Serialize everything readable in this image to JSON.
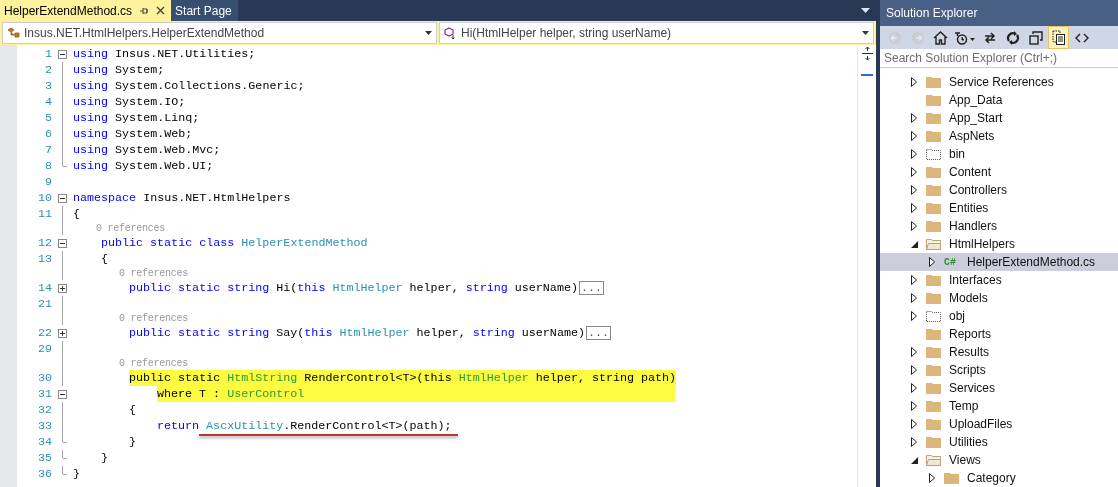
{
  "tabs": [
    {
      "label": "HelperExtendMethod.cs",
      "selected": true
    },
    {
      "label": "Start Page",
      "selected": false
    }
  ],
  "navigation_bar": {
    "type_dropdown": "Insus.NET.HtmlHelpers.HelperExtendMethod",
    "member_dropdown": "Hi(HtmlHelper helper, string userName)"
  },
  "code": [
    {
      "kind": "code",
      "number": "1",
      "expanded": true,
      "tokens": [
        {
          "t": "using ",
          "kind": "keyword"
        },
        {
          "t": "Insus.NET.Utilities;",
          "kind": "plain"
        }
      ]
    },
    {
      "kind": "code",
      "number": "2",
      "guide": true,
      "tokens": [
        {
          "t": "using ",
          "kind": "keyword"
        },
        {
          "t": "System;",
          "kind": "plain"
        }
      ]
    },
    {
      "kind": "code",
      "number": "3",
      "guide": true,
      "tokens": [
        {
          "t": "using ",
          "kind": "keyword"
        },
        {
          "t": "System.Collections.Generic;",
          "kind": "plain"
        }
      ]
    },
    {
      "kind": "code",
      "number": "4",
      "guide": true,
      "tokens": [
        {
          "t": "using ",
          "kind": "keyword"
        },
        {
          "t": "System.IO;",
          "kind": "plain"
        }
      ]
    },
    {
      "kind": "code",
      "number": "5",
      "guide": true,
      "tokens": [
        {
          "t": "using ",
          "kind": "keyword"
        },
        {
          "t": "System.Linq;",
          "kind": "plain"
        }
      ]
    },
    {
      "kind": "code",
      "number": "6",
      "guide": true,
      "tokens": [
        {
          "t": "using ",
          "kind": "keyword"
        },
        {
          "t": "System.Web;",
          "kind": "plain"
        }
      ]
    },
    {
      "kind": "code",
      "number": "7",
      "guide": true,
      "tokens": [
        {
          "t": "using ",
          "kind": "keyword"
        },
        {
          "t": "System.Web.Mvc;",
          "kind": "plain"
        }
      ]
    },
    {
      "kind": "code",
      "number": "8",
      "block_end": true,
      "tokens": [
        {
          "t": "using ",
          "kind": "keyword"
        },
        {
          "t": "System.Web.UI;",
          "kind": "plain"
        }
      ]
    },
    {
      "kind": "code",
      "number": "9"
    },
    {
      "kind": "code",
      "number": "10",
      "expanded": true,
      "tokens": [
        {
          "t": "namespace ",
          "kind": "keyword"
        },
        {
          "t": "Insus.NET.HtmlHelpers",
          "kind": "plain"
        }
      ]
    },
    {
      "kind": "code",
      "number": "11",
      "guide": true,
      "tokens": [
        {
          "t": "{",
          "kind": "plain"
        }
      ]
    },
    {
      "kind": "lens",
      "text": "    0 references"
    },
    {
      "kind": "code",
      "number": "12",
      "expanded": true,
      "tokens": [
        {
          "t": "    public static class ",
          "kind": "keyword"
        },
        {
          "t": "HelperExtendMethod",
          "kind": "type"
        }
      ]
    },
    {
      "kind": "code",
      "number": "13",
      "guide": true,
      "tokens": [
        {
          "t": "    {",
          "kind": "plain"
        }
      ]
    },
    {
      "kind": "lens",
      "text": "        0 references"
    },
    {
      "kind": "code",
      "number": "14",
      "expanded": false,
      "collapsed_text": "...",
      "tokens": [
        {
          "t": "        public static string",
          "kind": "keyword"
        },
        {
          "t": " Hi(",
          "kind": "plain"
        },
        {
          "t": "this ",
          "kind": "keyword"
        },
        {
          "t": "HtmlHelper",
          "kind": "type"
        },
        {
          "t": " helper, ",
          "kind": "plain"
        },
        {
          "t": "string",
          "kind": "keyword"
        },
        {
          "t": " userName)",
          "kind": "plain"
        }
      ]
    },
    {
      "kind": "code",
      "number": "21",
      "guide": true
    },
    {
      "kind": "lens",
      "text": "        0 references"
    },
    {
      "kind": "code",
      "number": "22",
      "expanded": false,
      "collapsed_text": "...",
      "tokens": [
        {
          "t": "        public static string",
          "kind": "keyword"
        },
        {
          "t": " Say(",
          "kind": "plain"
        },
        {
          "t": "this ",
          "kind": "keyword"
        },
        {
          "t": "HtmlHelper",
          "kind": "type"
        },
        {
          "t": " helper, ",
          "kind": "plain"
        },
        {
          "t": "string",
          "kind": "keyword"
        },
        {
          "t": " userName)",
          "kind": "plain"
        }
      ]
    },
    {
      "kind": "code",
      "number": "29",
      "guide": true
    },
    {
      "kind": "lens",
      "text": "        0 references"
    },
    {
      "kind": "code",
      "number": "30",
      "guide": true,
      "highlighted": true,
      "tokens": [
        {
          "t": "        public static ",
          "kind": "keyword"
        },
        {
          "t": "HtmlString",
          "kind": "type"
        },
        {
          "t": " RenderControl<T>(",
          "kind": "plain"
        },
        {
          "t": "this ",
          "kind": "keyword"
        },
        {
          "t": "HtmlHelper",
          "kind": "type"
        },
        {
          "t": " helper, ",
          "kind": "plain"
        },
        {
          "t": "string",
          "kind": "keyword"
        },
        {
          "t": " path)",
          "kind": "plain"
        }
      ]
    },
    {
      "kind": "code",
      "number": "31",
      "expanded": true,
      "highlighted": true,
      "tokens": [
        {
          "t": "            where",
          "kind": "keyword"
        },
        {
          "t": " T : ",
          "kind": "plain"
        },
        {
          "t": "UserControl",
          "kind": "type"
        }
      ]
    },
    {
      "kind": "code",
      "number": "32",
      "guide": true,
      "tokens": [
        {
          "t": "        {",
          "kind": "plain"
        }
      ]
    },
    {
      "kind": "code",
      "number": "33",
      "guide": true,
      "underlined": true,
      "tokens": [
        {
          "t": "            return ",
          "kind": "keyword"
        },
        {
          "t": "AscxUtility",
          "kind": "type"
        },
        {
          "t": ".RenderControl<T>(path);",
          "kind": "plain"
        }
      ]
    },
    {
      "kind": "code",
      "number": "34",
      "block_end": true,
      "tokens": [
        {
          "t": "        }",
          "kind": "plain"
        }
      ]
    },
    {
      "kind": "code",
      "number": "35",
      "block_end": true,
      "tokens": [
        {
          "t": "    }",
          "kind": "plain"
        }
      ]
    },
    {
      "kind": "code",
      "number": "36",
      "block_end": true,
      "tokens": [
        {
          "t": "}",
          "kind": "plain"
        }
      ]
    }
  ],
  "solution_explorer": {
    "title": "Solution Explorer",
    "toolbar": [
      {
        "kind": "back",
        "disabled": true,
        "selected": false
      },
      {
        "kind": "forward",
        "disabled": true,
        "selected": false
      },
      {
        "kind": "home",
        "disabled": false,
        "selected": false
      },
      {
        "kind": "history",
        "disabled": false,
        "selected": false
      },
      {
        "kind": "sync",
        "disabled": false,
        "selected": false
      },
      {
        "kind": "refresh",
        "disabled": false,
        "selected": false
      },
      {
        "kind": "collapse",
        "disabled": false,
        "selected": false
      },
      {
        "kind": "show-all",
        "disabled": false,
        "selected": true
      },
      {
        "kind": "code",
        "disabled": false,
        "selected": false
      }
    ],
    "search": {
      "placeholder": "Search Solution Explorer (Ctrl+;)"
    },
    "tree": [
      {
        "label": "Service References",
        "kind": "folder",
        "expandable": true,
        "expanded": false,
        "selected": false
      },
      {
        "label": "App_Data",
        "kind": "folder",
        "expandable": false,
        "selected": false
      },
      {
        "label": "App_Start",
        "kind": "folder",
        "expandable": true,
        "expanded": false,
        "selected": false
      },
      {
        "label": "AspNets",
        "kind": "folder",
        "expandable": true,
        "expanded": false,
        "selected": false
      },
      {
        "label": "bin",
        "kind": "hidden-folder",
        "expandable": true,
        "expanded": false,
        "selected": false
      },
      {
        "label": "Content",
        "kind": "folder",
        "expandable": true,
        "expanded": false,
        "selected": false
      },
      {
        "label": "Controllers",
        "kind": "folder",
        "expandable": true,
        "expanded": false,
        "selected": false
      },
      {
        "label": "Entities",
        "kind": "folder",
        "expandable": true,
        "expanded": false,
        "selected": false
      },
      {
        "label": "Handlers",
        "kind": "folder",
        "expandable": true,
        "expanded": false,
        "selected": false
      },
      {
        "label": "HtmlHelpers",
        "kind": "folder",
        "expandable": true,
        "expanded": true,
        "selected": false,
        "children": [
          {
            "label": "HelperExtendMethod.cs",
            "kind": "csharp",
            "icon_text": "C#",
            "expandable": true,
            "expanded": false,
            "selected": true
          }
        ]
      },
      {
        "label": "Interfaces",
        "kind": "folder",
        "expandable": true,
        "expanded": false,
        "selected": false
      },
      {
        "label": "Models",
        "kind": "folder",
        "expandable": true,
        "expanded": false,
        "selected": false
      },
      {
        "label": "obj",
        "kind": "hidden-folder",
        "expandable": true,
        "expanded": false,
        "selected": false
      },
      {
        "label": "Reports",
        "kind": "folder",
        "expandable": false,
        "selected": false
      },
      {
        "label": "Results",
        "kind": "folder",
        "expandable": true,
        "expanded": false,
        "selected": false
      },
      {
        "label": "Scripts",
        "kind": "folder",
        "expandable": true,
        "expanded": false,
        "selected": false
      },
      {
        "label": "Services",
        "kind": "folder",
        "expandable": true,
        "expanded": false,
        "selected": false
      },
      {
        "label": "Temp",
        "kind": "folder",
        "expandable": true,
        "expanded": false,
        "selected": false
      },
      {
        "label": "UploadFiles",
        "kind": "folder",
        "expandable": true,
        "expanded": false,
        "selected": false
      },
      {
        "label": "Utilities",
        "kind": "folder",
        "expandable": true,
        "expanded": false,
        "selected": false
      },
      {
        "label": "Views",
        "kind": "folder",
        "expandable": true,
        "expanded": true,
        "selected": false,
        "children": [
          {
            "label": "Category",
            "kind": "folder",
            "expandable": true,
            "expanded": false,
            "selected": false
          }
        ]
      }
    ]
  }
}
